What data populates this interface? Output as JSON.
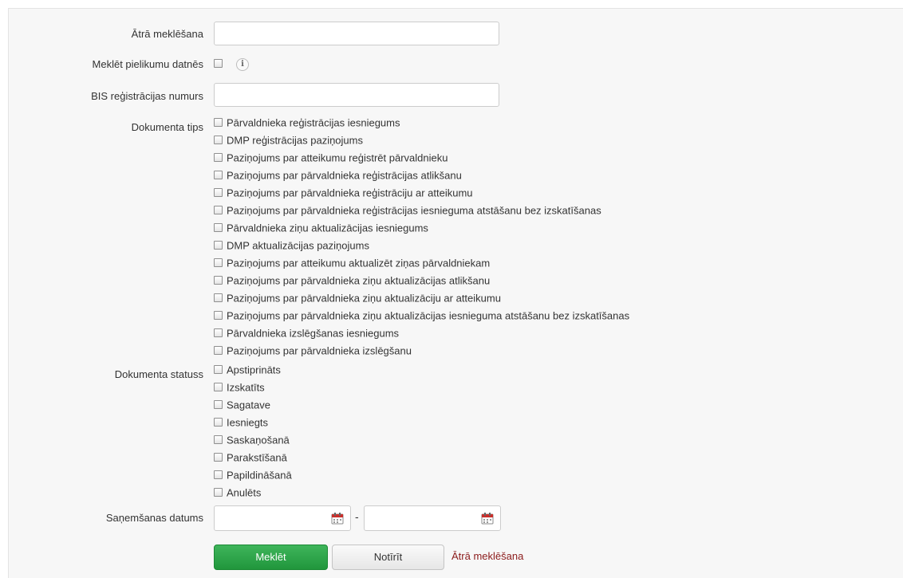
{
  "quick_search": {
    "label": "Ātrā meklēšana",
    "value": "",
    "placeholder": ""
  },
  "search_attachments": {
    "label": "Meklēt pielikumu datnēs",
    "checked": false,
    "info_icon": "info-icon"
  },
  "bis_number": {
    "label": "BIS reģistrācijas numurs",
    "value": "",
    "placeholder": ""
  },
  "doc_type": {
    "label": "Dokumenta tips",
    "options": [
      "Pārvaldnieka reģistrācijas iesniegums",
      "DMP reģistrācijas paziņojums",
      "Paziņojums par atteikumu reģistrēt pārvaldnieku",
      "Paziņojums par pārvaldnieka reģistrācijas atlikšanu",
      "Paziņojums par pārvaldnieka reģistrāciju ar atteikumu",
      "Paziņojums par pārvaldnieka reģistrācijas iesnieguma atstāšanu bez izskatīšanas",
      "Pārvaldnieka ziņu aktualizācijas iesniegums",
      "DMP aktualizācijas paziņojums",
      "Paziņojums par atteikumu aktualizēt ziņas pārvaldniekam",
      "Paziņojums par pārvaldnieka ziņu aktualizācijas atlikšanu",
      "Paziņojums par pārvaldnieka ziņu aktualizāciju ar atteikumu",
      "Paziņojums par pārvaldnieka ziņu aktualizācijas iesnieguma atstāšanu bez izskatīšanas",
      "Pārvaldnieka izslēgšanas iesniegums",
      "Paziņojums par pārvaldnieka izslēgšanu"
    ]
  },
  "doc_status": {
    "label": "Dokumenta statuss",
    "options": [
      "Apstiprināts",
      "Izskatīts",
      "Sagatave",
      "Iesniegts",
      "Saskaņošanā",
      "Parakstīšanā",
      "Papildināšanā",
      "Anulēts"
    ]
  },
  "received_date": {
    "label": "Saņemšanas datums",
    "from": "",
    "to": "",
    "separator": "-",
    "icon": "calendar-icon"
  },
  "actions": {
    "search": "Meklēt",
    "clear": "Notīrīt",
    "quick_link": "Ātrā meklēšana"
  },
  "colors": {
    "search_button": "#21963c",
    "link": "#8b1a1a",
    "panel_bg": "#f7f7f7"
  }
}
